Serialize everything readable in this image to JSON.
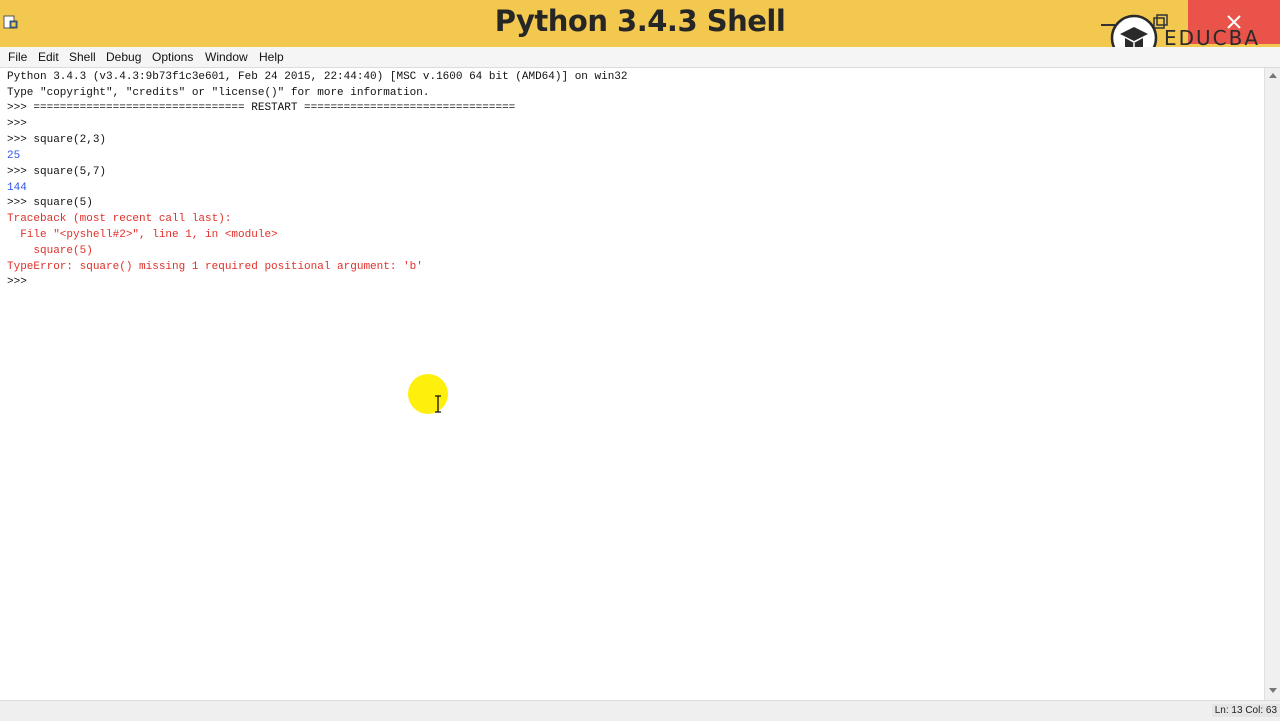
{
  "window": {
    "title": "Python 3.4.3 Shell",
    "watermark_text": "EDUCBA",
    "colors": {
      "titlebar": "#f3c84f",
      "close": "#e9534a"
    }
  },
  "menu": {
    "items": [
      {
        "label": "File"
      },
      {
        "label": "Edit"
      },
      {
        "label": "Shell"
      },
      {
        "label": "Debug"
      },
      {
        "label": "Options"
      },
      {
        "label": "Window"
      },
      {
        "label": "Help"
      }
    ]
  },
  "shell": {
    "lines": [
      {
        "text": "Python 3.4.3 (v3.4.3:9b73f1c3e601, Feb 24 2015, 22:44:40) [MSC v.1600 64 bit (AMD64)] on win32",
        "color": "black"
      },
      {
        "text": "Type \"copyright\", \"credits\" or \"license()\" for more information.",
        "color": "black"
      },
      {
        "text": ">>> ================================ RESTART ================================",
        "color": "black"
      },
      {
        "text": ">>> ",
        "color": "black"
      },
      {
        "text": ">>> square(2,3)",
        "color": "black"
      },
      {
        "text": "25",
        "color": "blue"
      },
      {
        "text": ">>> square(5,7)",
        "color": "black"
      },
      {
        "text": "144",
        "color": "blue"
      },
      {
        "text": ">>> square(5)",
        "color": "black"
      },
      {
        "text": "Traceback (most recent call last):",
        "color": "red"
      },
      {
        "text": "  File \"<pyshell#2>\", line 1, in <module>",
        "color": "red"
      },
      {
        "text": "    square(5)",
        "color": "red"
      },
      {
        "text": "TypeError: square() missing 1 required positional argument: 'b'",
        "color": "red"
      },
      {
        "text": ">>> ",
        "color": "black"
      }
    ]
  },
  "status": {
    "text": "Ln: 13  Col: 63"
  }
}
